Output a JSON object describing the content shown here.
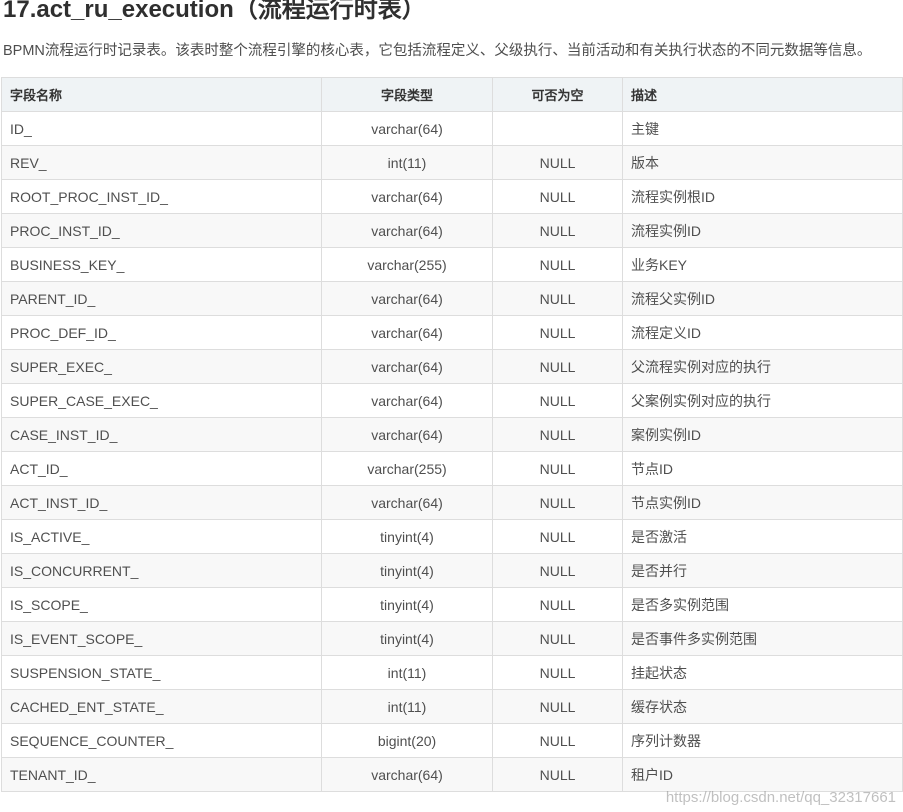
{
  "title": "17.act_ru_execution（流程运行时表）",
  "description": "BPMN流程运行时记录表。该表时整个流程引擎的核心表，它包括流程定义、父级执行、当前活动和有关执行状态的不同元数据等信息。",
  "table": {
    "headers": [
      "字段名称",
      "字段类型",
      "可否为空",
      "描述"
    ],
    "rows": [
      [
        "ID_",
        "varchar(64)",
        "",
        "主键"
      ],
      [
        "REV_",
        "int(11)",
        "NULL",
        "版本"
      ],
      [
        "ROOT_PROC_INST_ID_",
        "varchar(64)",
        "NULL",
        "流程实例根ID"
      ],
      [
        "PROC_INST_ID_",
        "varchar(64)",
        "NULL",
        "流程实例ID"
      ],
      [
        "BUSINESS_KEY_",
        "varchar(255)",
        "NULL",
        "业务KEY"
      ],
      [
        "PARENT_ID_",
        "varchar(64)",
        "NULL",
        "流程父实例ID"
      ],
      [
        "PROC_DEF_ID_",
        "varchar(64)",
        "NULL",
        "流程定义ID"
      ],
      [
        "SUPER_EXEC_",
        "varchar(64)",
        "NULL",
        "父流程实例对应的执行"
      ],
      [
        "SUPER_CASE_EXEC_",
        "varchar(64)",
        "NULL",
        "父案例实例对应的执行"
      ],
      [
        "CASE_INST_ID_",
        "varchar(64)",
        "NULL",
        "案例实例ID"
      ],
      [
        "ACT_ID_",
        "varchar(255)",
        "NULL",
        "节点ID"
      ],
      [
        "ACT_INST_ID_",
        "varchar(64)",
        "NULL",
        "节点实例ID"
      ],
      [
        "IS_ACTIVE_",
        "tinyint(4)",
        "NULL",
        "是否激活"
      ],
      [
        "IS_CONCURRENT_",
        "tinyint(4)",
        "NULL",
        "是否并行"
      ],
      [
        "IS_SCOPE_",
        "tinyint(4)",
        "NULL",
        "是否多实例范围"
      ],
      [
        "IS_EVENT_SCOPE_",
        "tinyint(4)",
        "NULL",
        "是否事件多实例范围"
      ],
      [
        "SUSPENSION_STATE_",
        "int(11)",
        "NULL",
        "挂起状态"
      ],
      [
        "CACHED_ENT_STATE_",
        "int(11)",
        "NULL",
        "缓存状态"
      ],
      [
        "SEQUENCE_COUNTER_",
        "bigint(20)",
        "NULL",
        "序列计数器"
      ],
      [
        "TENANT_ID_",
        "varchar(64)",
        "NULL",
        "租户ID"
      ]
    ]
  },
  "watermark": "https://blog.csdn.net/qq_32317661"
}
